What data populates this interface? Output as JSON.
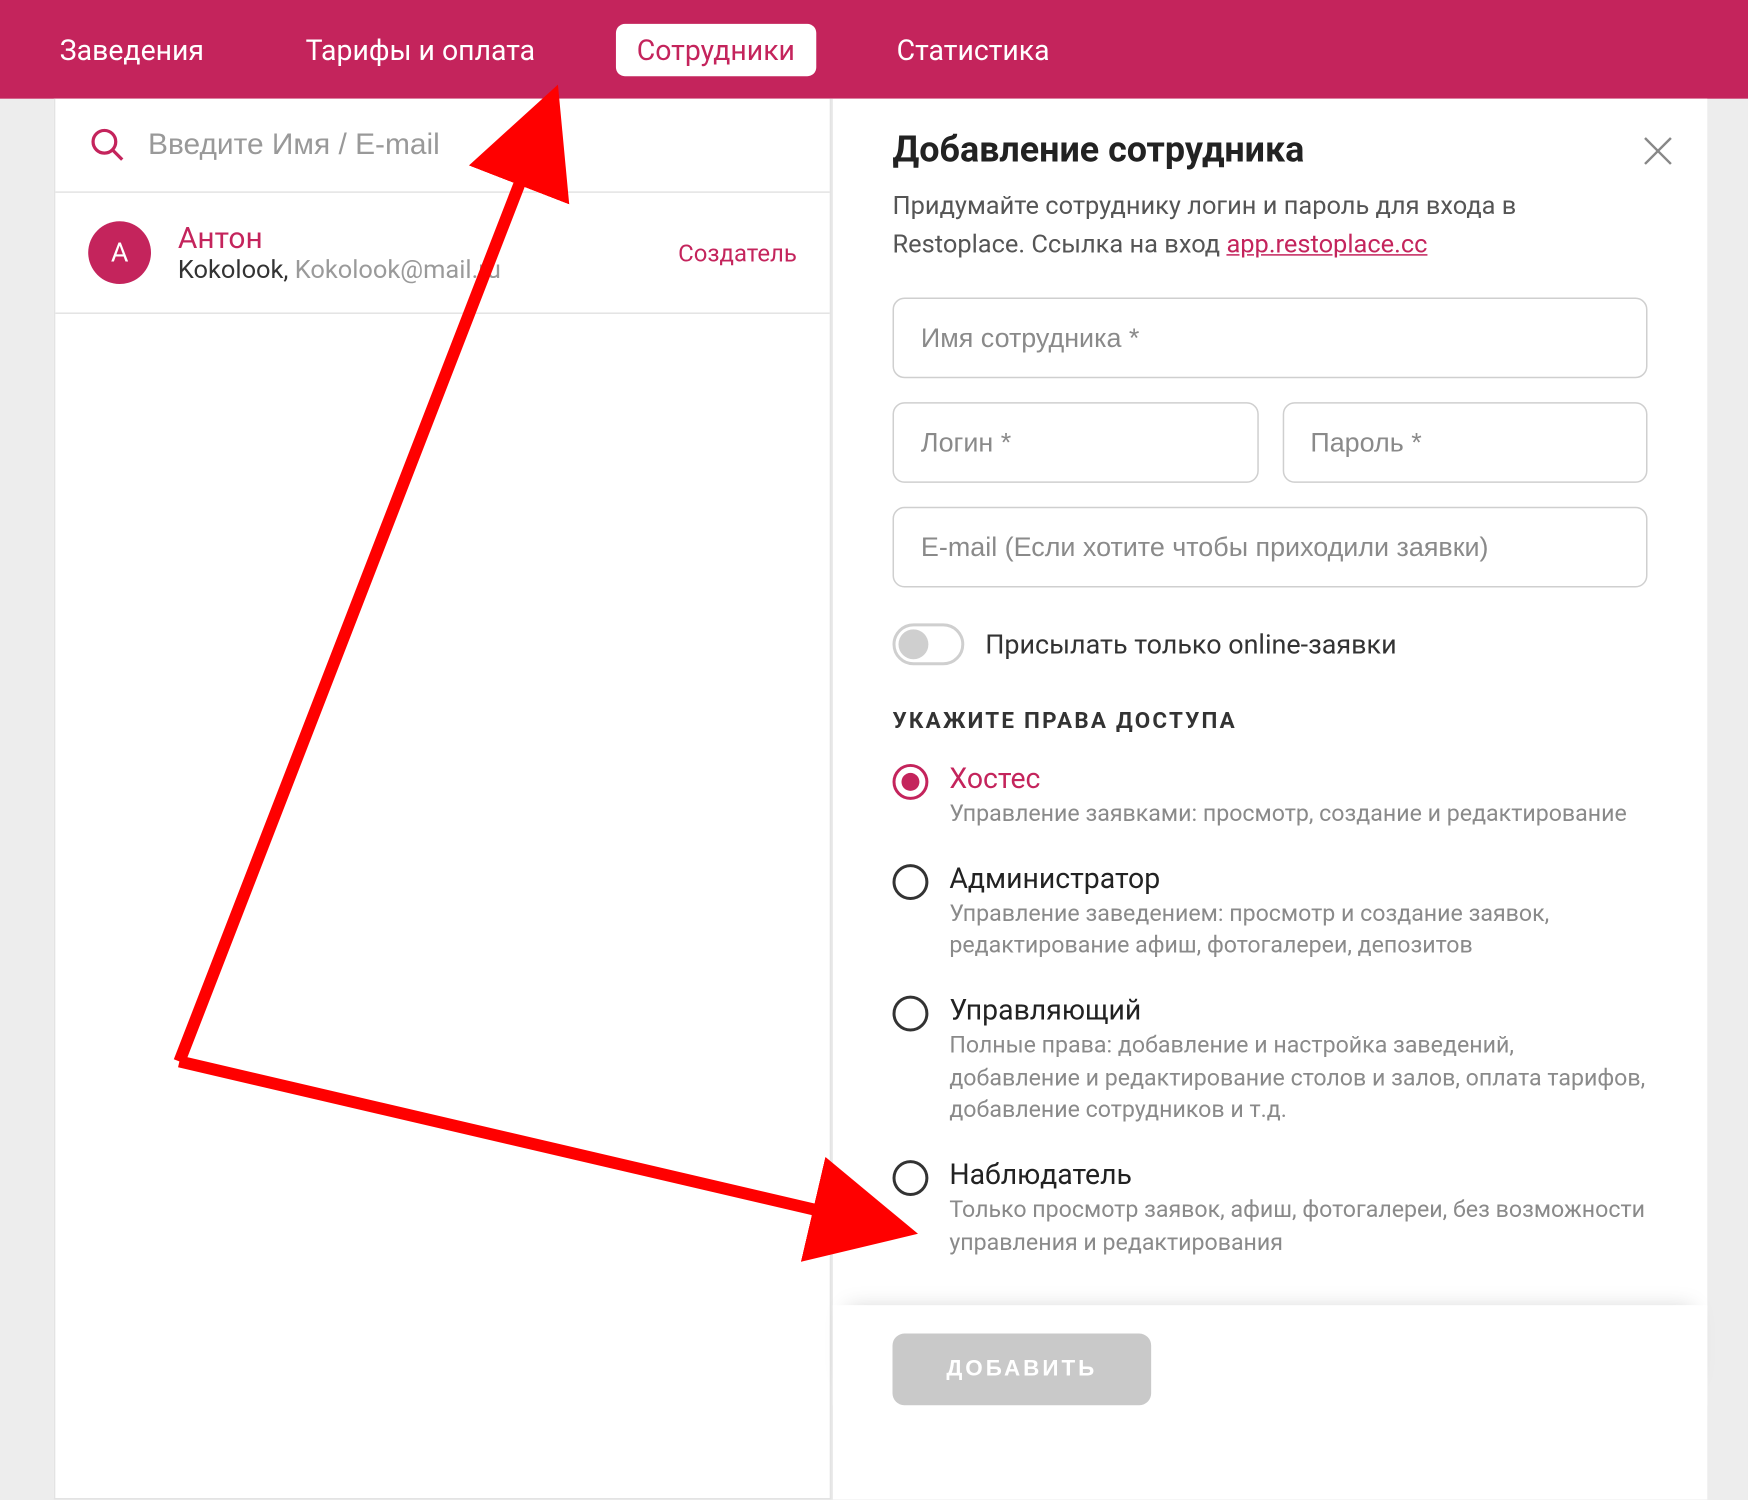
{
  "nav": {
    "items": [
      {
        "label": "Заведения",
        "active": false
      },
      {
        "label": "Тарифы и оплата",
        "active": false
      },
      {
        "label": "Сотрудники",
        "active": true
      },
      {
        "label": "Статистика",
        "active": false
      }
    ]
  },
  "search": {
    "placeholder": "Введите Имя / E-mail"
  },
  "employees": [
    {
      "initial": "А",
      "name": "Антон",
      "org": "Kokolook,",
      "email": "Kokolook@mail.ru",
      "role": "Создатель"
    }
  ],
  "panel": {
    "title": "Добавление сотрудника",
    "description_prefix": "Придумайте сотруднику логин и пароль для входа в Restoplace. Ссылка на вход ",
    "link_text": "app.restoplace.cc",
    "fields": {
      "name_placeholder": "Имя сотрудника *",
      "login_placeholder": "Логин *",
      "password_placeholder": "Пароль *",
      "email_placeholder": "E-mail (Если хотите чтобы приходили заявки)"
    },
    "toggle_label": "Присылать только online-заявки",
    "rights_title": "УКАЖИТЕ ПРАВА ДОСТУПА",
    "roles": [
      {
        "title": "Хостес",
        "desc": "Управление заявками: просмотр, создание и редактирование",
        "selected": true
      },
      {
        "title": "Администратор",
        "desc": "Управление заведением: просмотр и создание заявок, редактирование афиш, фотогалереи, депозитов",
        "selected": false
      },
      {
        "title": "Управляющий",
        "desc": "Полные права: добавление и настройка заведений, добавление и редактирование столов и залов, оплата тарифов, добавление сотрудников и т.д.",
        "selected": false
      },
      {
        "title": "Наблюдатель",
        "desc": "Только просмотр заявок, афиш, фотогалереи, без возможности управления и редактирования",
        "selected": false
      }
    ],
    "submit_label": "ДОБАВИТЬ"
  }
}
